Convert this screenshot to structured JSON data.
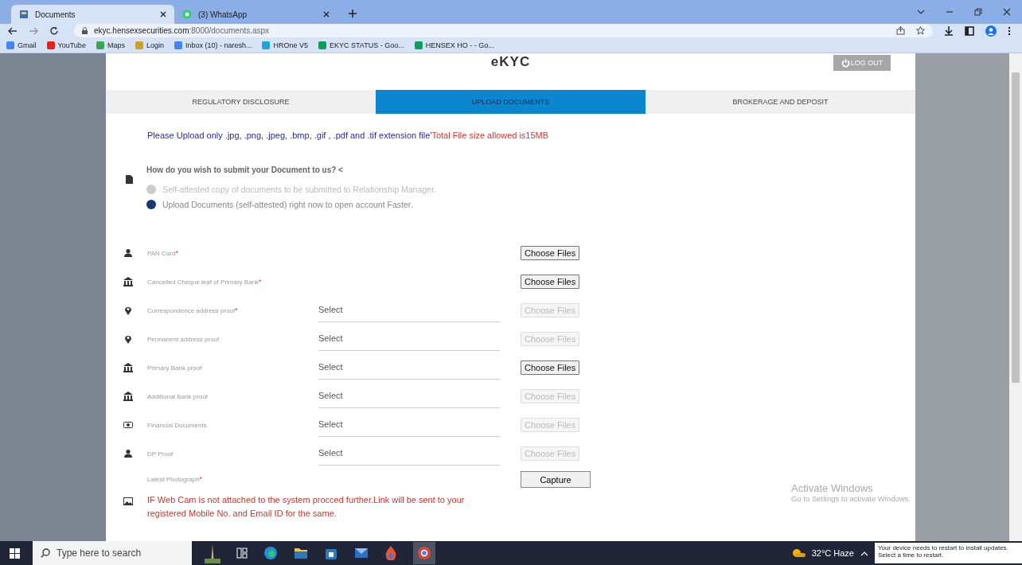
{
  "browser": {
    "tabs": [
      {
        "title": "Documents",
        "selected": true,
        "kind": "page"
      },
      {
        "title": "(3) WhatsApp",
        "selected": false,
        "kind": "chat"
      }
    ],
    "url_host": "ekyc.hensexsecurities.com",
    "url_path": ":8000/documents.aspx",
    "bookmarks": [
      {
        "label": "Gmail",
        "color": "#4285f4"
      },
      {
        "label": "YouTube",
        "color": "#e62117"
      },
      {
        "label": "Maps",
        "color": "#34a853"
      },
      {
        "label": "Login",
        "color": "#c9a227"
      },
      {
        "label": "Inbox (10) - naresh...",
        "color": "#4285f4"
      },
      {
        "label": "HROne V5",
        "color": "#1fa3d9"
      },
      {
        "label": "EKYC STATUS - Goo...",
        "color": "#0f9d58"
      },
      {
        "label": "HENSEX HO - - Go...",
        "color": "#0f9d58"
      }
    ]
  },
  "page": {
    "title": "eKYC",
    "logout": "LOG OUT",
    "tabs": [
      {
        "label": "REGULATORY DISCLOSURE",
        "selected": false
      },
      {
        "label": "UPLOAD DOCUMENTS",
        "selected": true
      },
      {
        "label": "BROKERAGE AND DEPOSIT",
        "selected": false
      }
    ],
    "notice": "Please Upload only .jpg, .png, .jpeg, .bmp, .gif , .pdf and .tif extension file'",
    "notice_limit": "Total File size allowed is15MB",
    "question": "How do you wish to submit your Document to us? <",
    "options": [
      {
        "label": "Self-attested copy of documents to be submitted to Relationship Manager.",
        "selected": false
      },
      {
        "label": "Upload Documents (self-attested) right now to open account Faster.",
        "selected": true
      }
    ],
    "documents": [
      {
        "kind": "person",
        "label": "PAN Card",
        "required_mark": "*",
        "button": "Choose Files",
        "disabled": false
      },
      {
        "kind": "bank",
        "label": "Cancelled Cheque leaf of Primary Bank",
        "required_mark": "*",
        "button": "Choose Files",
        "disabled": false
      },
      {
        "kind": "pin",
        "label": "Correspondence address proof",
        "required_mark": "*",
        "select": "Select",
        "button": "Choose Files",
        "disabled": true
      },
      {
        "kind": "pin",
        "label": "Permanent address proof",
        "select": "Select",
        "button": "Choose Files",
        "disabled": true
      },
      {
        "kind": "bank",
        "label": "Primary Bank proof",
        "select": "Select",
        "button": "Choose Files",
        "disabled": false
      },
      {
        "kind": "bank",
        "label": "Additional Bank proof",
        "select": "Select",
        "button": "Choose Files",
        "disabled": true
      },
      {
        "kind": "money",
        "label": "Financial Documents",
        "select": "Select",
        "button": "Choose Files",
        "disabled": true
      },
      {
        "kind": "person",
        "label": "DP Proof",
        "select": "Select",
        "button": "Choose Files",
        "disabled": true
      }
    ],
    "photo": {
      "label": "Latest Photograph",
      "required_mark": "*",
      "button": "Capture",
      "warning": "IF Web Cam is not attached to the system procced further.Link will be sent to your registered Mobile No. and Email ID for the same."
    }
  },
  "activation_notice": {
    "title": "Activate Windows",
    "subtitle": "Go to Settings to activate Windows."
  },
  "taskbar": {
    "search_placeholder": "Type here to search",
    "weather": "32°C Haze",
    "notification": [
      "Your device needs to restart to install updates.",
      "Select a time to restart."
    ]
  }
}
